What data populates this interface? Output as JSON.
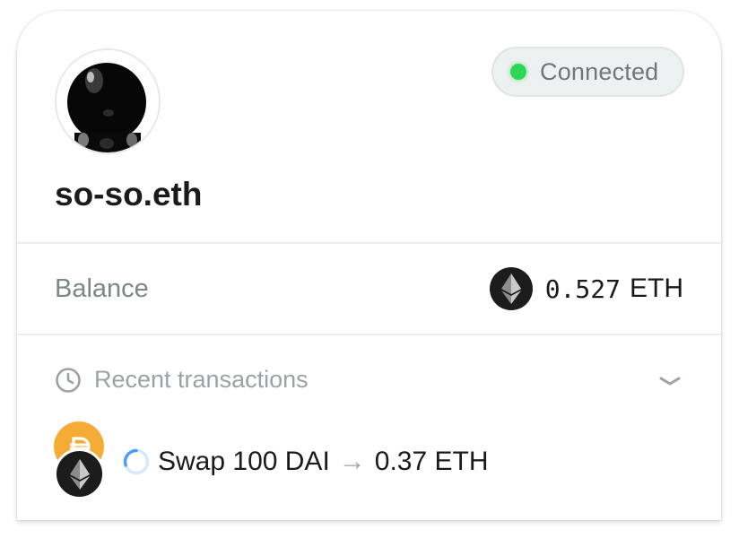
{
  "wallet": {
    "ens_name": "so-so.eth",
    "avatar_icon": "avatar-image",
    "status": {
      "label": "Connected",
      "color": "#2dd656"
    }
  },
  "balance": {
    "label": "Balance",
    "amount": "0.527",
    "unit": "ETH",
    "icon": "eth-icon"
  },
  "transactions": {
    "title": "Recent transactions",
    "items": [
      {
        "from_token": "DAI",
        "to_token": "ETH",
        "from_text": "Swap 100 DAI",
        "arrow": "→",
        "to_text": "0.37 ETH",
        "state": "pending"
      }
    ]
  },
  "colors": {
    "accent_blue": "#4a9df8",
    "dai_yellow": "#f5ac37",
    "eth_dark": "#1c1c1c"
  }
}
